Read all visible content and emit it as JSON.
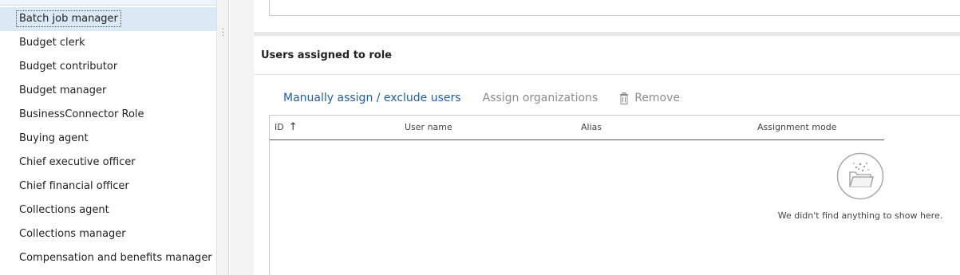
{
  "roles": {
    "items": [
      {
        "label": "Batch job manager",
        "selected": true
      },
      {
        "label": "Budget clerk"
      },
      {
        "label": "Budget contributor"
      },
      {
        "label": "Budget manager"
      },
      {
        "label": "BusinessConnector Role"
      },
      {
        "label": "Buying agent"
      },
      {
        "label": "Chief executive officer"
      },
      {
        "label": "Chief financial officer"
      },
      {
        "label": "Collections agent"
      },
      {
        "label": "Collections manager"
      },
      {
        "label": "Compensation and benefits manager"
      }
    ]
  },
  "splitter": {
    "grip_icon": "vertical-ellipsis-icon"
  },
  "users_section": {
    "title": "Users assigned to role",
    "toolbar": {
      "manual_assign_label": "Manually assign / exclude users",
      "assign_orgs_label": "Assign organizations",
      "remove_label": "Remove",
      "remove_icon": "trash-icon"
    },
    "grid": {
      "columns": [
        "ID",
        "User name",
        "Alias",
        "Assignment mode"
      ],
      "sort_indicator": "↑",
      "sorted_column": "ID",
      "sort_direction": "ascending",
      "rows": []
    },
    "empty_state": {
      "icon": "empty-folder-icon",
      "message": "We didn't find anything to show here."
    }
  },
  "colors": {
    "selected_row": "#dbe9f7",
    "link_blue": "#1f5f9e",
    "disabled_text": "#8c8c8c"
  }
}
